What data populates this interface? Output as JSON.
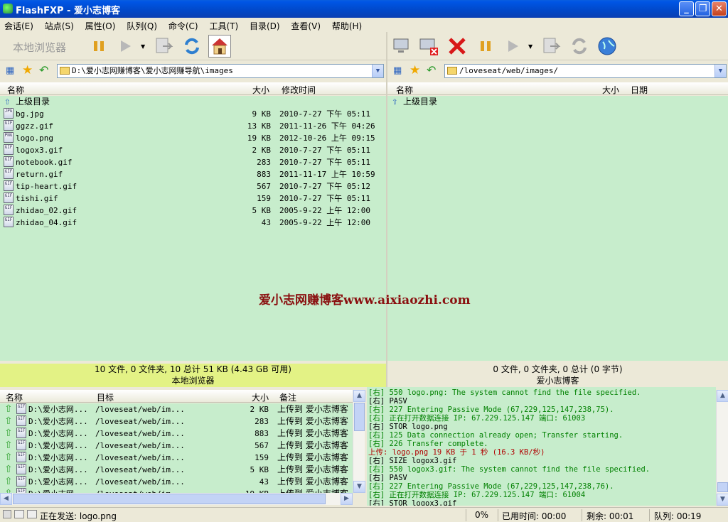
{
  "window": {
    "title": "FlashFXP - 爱小志博客"
  },
  "menu": [
    "会话(E)",
    "站点(S)",
    "属性(O)",
    "队列(Q)",
    "命令(C)",
    "工具(T)",
    "目录(D)",
    "查看(V)",
    "帮助(H)"
  ],
  "local": {
    "toolbar_label": "本地浏览器",
    "path": "D:\\爱小志网赚博客\\爱小志网赚导航\\images",
    "headers": {
      "name": "名称",
      "size": "大小",
      "modified": "修改时间"
    },
    "parent": "上级目录",
    "files": [
      {
        "name": "bg.jpg",
        "size": "9 KB",
        "date": "2010-7-27 下午 05:11",
        "icon": "JPG"
      },
      {
        "name": "ggzz.gif",
        "size": "13 KB",
        "date": "2011-11-26 下午 04:26",
        "icon": "GIF"
      },
      {
        "name": "logo.png",
        "size": "19 KB",
        "date": "2012-10-26 上午 09:15",
        "icon": "PNG"
      },
      {
        "name": "logox3.gif",
        "size": "2 KB",
        "date": "2010-7-27 下午 05:11",
        "icon": "GIF"
      },
      {
        "name": "notebook.gif",
        "size": "283",
        "date": "2010-7-27 下午 05:11",
        "icon": "GIF"
      },
      {
        "name": "return.gif",
        "size": "883",
        "date": "2011-11-17 上午 10:59",
        "icon": "GIF"
      },
      {
        "name": "tip-heart.gif",
        "size": "567",
        "date": "2010-7-27 下午 05:12",
        "icon": "GIF"
      },
      {
        "name": "tishi.gif",
        "size": "159",
        "date": "2010-7-27 下午 05:11",
        "icon": "GIF"
      },
      {
        "name": "zhidao_02.gif",
        "size": "5 KB",
        "date": "2005-9-22 上午 12:00",
        "icon": "GIF"
      },
      {
        "name": "zhidao_04.gif",
        "size": "43",
        "date": "2005-9-22 上午 12:00",
        "icon": "GIF"
      }
    ],
    "status": "10 文件, 0 文件夹, 10 总计 51 KB (4.43 GB 可用)",
    "status_label": "本地浏览器"
  },
  "remote": {
    "path": "/loveseat/web/images/",
    "headers": {
      "name": "名称",
      "size": "大小",
      "date": "日期"
    },
    "parent": "上级目录",
    "status": "0 文件, 0 文件夹, 0 总计 (0 字节)",
    "status_label": "爱小志博客"
  },
  "watermark": "爱小志网赚博客www.aixiaozhi.com",
  "queue": {
    "headers": {
      "name": "名称",
      "target": "目标",
      "size": "大小",
      "note": "备注"
    },
    "items": [
      {
        "name": "D:\\爱小志网...",
        "target": "/loveseat/web/im...",
        "size": "2 KB",
        "note": "上传到 爱小志博客"
      },
      {
        "name": "D:\\爱小志网...",
        "target": "/loveseat/web/im...",
        "size": "283",
        "note": "上传到 爱小志博客"
      },
      {
        "name": "D:\\爱小志网...",
        "target": "/loveseat/web/im...",
        "size": "883",
        "note": "上传到 爱小志博客"
      },
      {
        "name": "D:\\爱小志网...",
        "target": "/loveseat/web/im...",
        "size": "567",
        "note": "上传到 爱小志博客"
      },
      {
        "name": "D:\\爱小志网...",
        "target": "/loveseat/web/im...",
        "size": "159",
        "note": "上传到 爱小志博客"
      },
      {
        "name": "D:\\爱小志网...",
        "target": "/loveseat/web/im...",
        "size": "5 KB",
        "note": "上传到 爱小志博客"
      },
      {
        "name": "D:\\爱小志网...",
        "target": "/loveseat/web/im...",
        "size": "43",
        "note": "上传到 爱小志博客"
      },
      {
        "name": "D:\\爱小志网...",
        "target": "/loveseat/web/im...",
        "size": "19 KB",
        "note": "上传到 爱小志博客"
      }
    ]
  },
  "log": [
    {
      "text": "[右] 550 logo.png: The system cannot find the file specified.",
      "color": "#008000"
    },
    {
      "text": "[右] PASV",
      "color": "#000000"
    },
    {
      "text": "[右] 227 Entering Passive Mode (67,229,125,147,238,75).",
      "color": "#008000"
    },
    {
      "text": "[右] 正在打开数据连接 IP: 67.229.125.147 端口: 61003",
      "color": "#008000"
    },
    {
      "text": "[右] STOR logo.png",
      "color": "#000000"
    },
    {
      "text": "[右] 125 Data connection already open; Transfer starting.",
      "color": "#008000"
    },
    {
      "text": "[右] 226 Transfer complete.",
      "color": "#008000"
    },
    {
      "text": "上传: logo.png 19 KB 于 1 秒 (16.3 KB/秒)",
      "color": "#b00000"
    },
    {
      "text": "[右] SIZE logox3.gif",
      "color": "#000000"
    },
    {
      "text": "[右] 550 logox3.gif: The system cannot find the file specified.",
      "color": "#008000"
    },
    {
      "text": "[右] PASV",
      "color": "#000000"
    },
    {
      "text": "[右] 227 Entering Passive Mode (67,229,125,147,238,76).",
      "color": "#008000"
    },
    {
      "text": "[右] 正在打开数据连接 IP: 67.229.125.147 端口: 61004",
      "color": "#008000"
    },
    {
      "text": "[右] STOR logox3.gif",
      "color": "#000000"
    }
  ],
  "bottom": {
    "sending": "正在发送: logo.png",
    "percent": "0%",
    "elapsed": "已用时间: 00:00",
    "remaining": "剩余: 00:01",
    "queue": "队列: 00:19"
  }
}
